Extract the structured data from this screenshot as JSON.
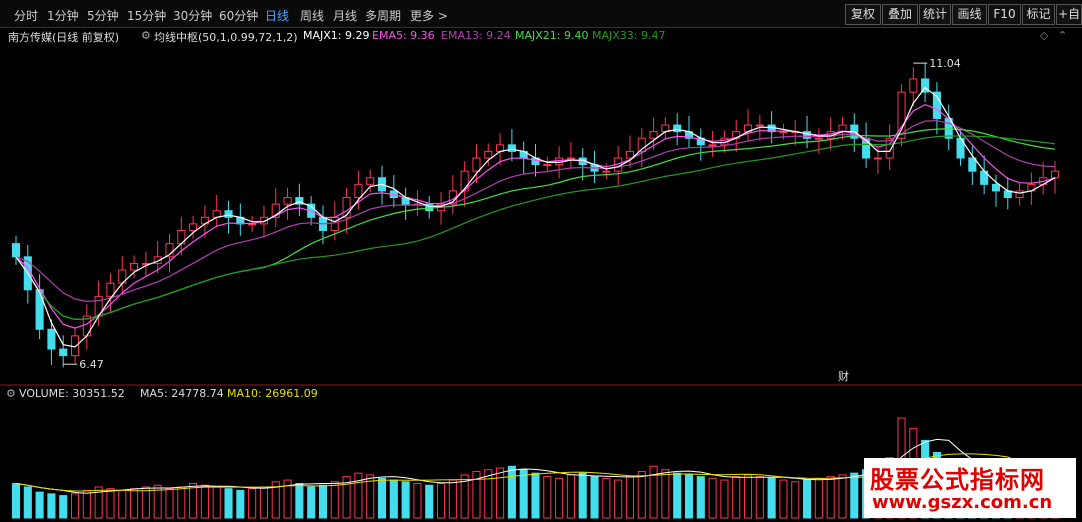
{
  "toolbar": {
    "periods": [
      "分时",
      "1分钟",
      "5分钟",
      "15分钟",
      "30分钟",
      "60分钟",
      "日线",
      "周线",
      "月线",
      "多周期",
      "更多 >"
    ],
    "active_period": "日线",
    "buttons": [
      "复权",
      "叠加",
      "统计",
      "画线",
      "F10",
      "标记",
      "+自"
    ]
  },
  "main_panel": {
    "title": "南方传媒(日线 前复权)",
    "indicator_name": "均线中枢(50,1,0.99,72,1,2)",
    "indicators": [
      {
        "label": "MAJX1: 9.29",
        "color": "#ffffff"
      },
      {
        "label": "EMA5: 9.36",
        "color": "#ff4ff0"
      },
      {
        "label": "EMA13: 9.24",
        "color": "#b040b0"
      },
      {
        "label": "MAJX21: 9.40",
        "color": "#44dd44"
      },
      {
        "label": "MAJX33: 9.47",
        "color": "#229922"
      }
    ],
    "high_label": "11.04",
    "low_label": "6.47",
    "finance_marker": "财"
  },
  "volume_panel": {
    "items": [
      {
        "label": "VOLUME: 30351.52",
        "color": "#dddddd"
      },
      {
        "label": "MA5: 24778.74",
        "color": "#dddddd"
      },
      {
        "label": "MA10: 26961.09",
        "color": "#e8e000"
      }
    ]
  },
  "colors": {
    "up": "#ff3355",
    "down": "#44ddee",
    "ma_white": "#ffffff",
    "ema5": "#ff4ff0",
    "ema13": "#b040b0",
    "ma21": "#44dd44",
    "ma33": "#229922",
    "ma10_vol": "#e8e000"
  },
  "watermark": {
    "line1": "股票公式指标网",
    "line2": "www.gszx.com.cn"
  },
  "chart_data": {
    "type": "candlestick",
    "price_range": [
      6.2,
      11.3
    ],
    "close_series": [
      8.1,
      7.6,
      7.0,
      6.7,
      6.6,
      6.9,
      7.2,
      7.5,
      7.7,
      7.9,
      8.0,
      8.0,
      8.1,
      8.3,
      8.5,
      8.6,
      8.7,
      8.8,
      8.7,
      8.6,
      8.6,
      8.7,
      8.9,
      9.0,
      8.9,
      8.7,
      8.5,
      8.7,
      9.0,
      9.2,
      9.3,
      9.1,
      9.0,
      8.9,
      8.9,
      8.8,
      8.9,
      9.1,
      9.4,
      9.6,
      9.7,
      9.8,
      9.7,
      9.6,
      9.5,
      9.5,
      9.6,
      9.6,
      9.5,
      9.4,
      9.4,
      9.6,
      9.7,
      9.9,
      10.0,
      10.1,
      10.0,
      9.9,
      9.8,
      9.8,
      9.9,
      10.0,
      10.1,
      10.1,
      10.0,
      10.0,
      10.0,
      9.9,
      9.9,
      10.0,
      10.1,
      9.9,
      9.6,
      9.6,
      9.9,
      10.6,
      10.8,
      10.6,
      10.2,
      9.9,
      9.6,
      9.4,
      9.2,
      9.1,
      9.0,
      9.1,
      9.2,
      9.3,
      9.4
    ],
    "volume_series": [
      20,
      18,
      15,
      14,
      13,
      14,
      16,
      18,
      17,
      16,
      17,
      18,
      19,
      17,
      18,
      20,
      19,
      18,
      17,
      16,
      17,
      18,
      21,
      22,
      20,
      18,
      19,
      21,
      24,
      26,
      25,
      23,
      22,
      21,
      20,
      19,
      20,
      22,
      25,
      27,
      28,
      29,
      30,
      28,
      26,
      24,
      23,
      25,
      26,
      24,
      23,
      22,
      24,
      27,
      30,
      28,
      26,
      25,
      24,
      23,
      22,
      24,
      25,
      24,
      23,
      22,
      21,
      22,
      23,
      24,
      25,
      26,
      28,
      30,
      35,
      58,
      52,
      45,
      38,
      32,
      28,
      26,
      25,
      24,
      26,
      28,
      30,
      32,
      30
    ],
    "high": 11.04,
    "low": 6.47
  }
}
